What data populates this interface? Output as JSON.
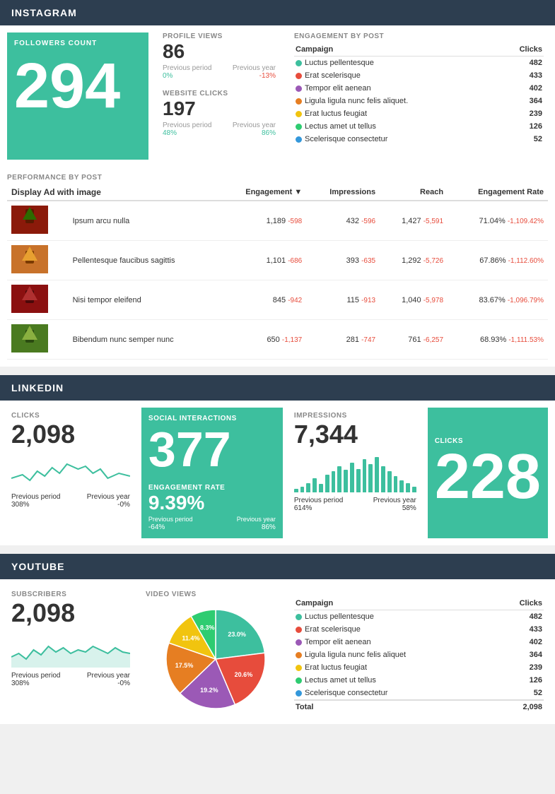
{
  "instagram": {
    "header": "INSTAGRAM",
    "followers": {
      "label": "FOLLOWERS COUNT",
      "value": "294"
    },
    "profile_views": {
      "label": "PROFILE VIEWS",
      "value": "86",
      "prev_period_label": "Previous period",
      "prev_period_value": "0%",
      "prev_year_label": "Previous year",
      "prev_year_value": "-13%"
    },
    "website_clicks": {
      "label": "WEBSITE CLICKS",
      "value": "197",
      "prev_period_label": "Previous period",
      "prev_period_value": "48%",
      "prev_year_label": "Previous year",
      "prev_year_value": "86%"
    },
    "engagement": {
      "label": "ENGAGEMENT BY POST",
      "col1": "Campaign",
      "col2": "Clicks",
      "rows": [
        {
          "color": "#3dbf9e",
          "name": "Luctus pellentesque",
          "clicks": "482"
        },
        {
          "color": "#e74c3c",
          "name": "Erat scelerisque",
          "clicks": "433"
        },
        {
          "color": "#9b59b6",
          "name": "Tempor elit aenean",
          "clicks": "402"
        },
        {
          "color": "#e67e22",
          "name": "Ligula ligula nunc felis aliquet.",
          "clicks": "364"
        },
        {
          "color": "#f1c40f",
          "name": "Erat luctus feugiat",
          "clicks": "239"
        },
        {
          "color": "#2ecc71",
          "name": "Lectus amet ut tellus",
          "clicks": "126"
        },
        {
          "color": "#3498db",
          "name": "Scelerisque consectetur",
          "clicks": "52"
        }
      ]
    },
    "performance": {
      "label": "PERFORMANCE BY POST",
      "subtitle": "Display Ad with image",
      "columns": [
        "",
        "Engagement",
        "Impressions",
        "Reach",
        "Engagement Rate"
      ],
      "rows": [
        {
          "img_color": "#8B1A0A",
          "name": "Ipsum arcu nulla",
          "engagement": "1,189",
          "engagement_delta": "-598",
          "impressions": "432",
          "impressions_delta": "-596",
          "reach": "1,427",
          "reach_delta": "-5,591",
          "rate": "71.04%",
          "rate_delta": "-1,109.42%"
        },
        {
          "img_color": "#D4640A",
          "name": "Pellentesque faucibus sagittis",
          "engagement": "1,101",
          "engagement_delta": "-686",
          "impressions": "393",
          "impressions_delta": "-635",
          "reach": "1,292",
          "reach_delta": "-5,726",
          "rate": "67.86%",
          "rate_delta": "-1,112.60%"
        },
        {
          "img_color": "#7B1010",
          "name": "Nisi tempor eleifend",
          "engagement": "845",
          "engagement_delta": "-942",
          "impressions": "115",
          "impressions_delta": "-913",
          "reach": "1,040",
          "reach_delta": "-5,978",
          "rate": "83.67%",
          "rate_delta": "-1,096.79%"
        },
        {
          "img_color": "#3A6B20",
          "name": "Bibendum nunc semper nunc",
          "engagement": "650",
          "engagement_delta": "-1,137",
          "impressions": "281",
          "impressions_delta": "-747",
          "reach": "761",
          "reach_delta": "-6,257",
          "rate": "68.93%",
          "rate_delta": "-1,111.53%"
        }
      ]
    }
  },
  "linkedin": {
    "header": "LINKEDIN",
    "clicks": {
      "label": "CLICKS",
      "value": "2,098",
      "prev_period_label": "Previous period",
      "prev_period_value": "308%",
      "prev_year_label": "Previous year",
      "prev_year_value": "-0%"
    },
    "social_interactions": {
      "label": "SOCIAL INTERACTIONS",
      "value": "377",
      "eng_label": "ENGAGEMENT RATE",
      "eng_value": "9.39%",
      "eng_prev_period": "-64%",
      "eng_prev_year": "86%"
    },
    "impressions": {
      "label": "IMPRESSIONS",
      "value": "7,344",
      "prev_period_label": "Previous period",
      "prev_period_value": "614%",
      "prev_year_label": "Previous year",
      "prev_year_value": "58%",
      "bars": [
        3,
        5,
        8,
        12,
        7,
        15,
        18,
        22,
        19,
        25,
        20,
        28,
        24,
        30,
        22,
        18,
        14,
        10,
        8,
        5
      ]
    },
    "li_clicks": {
      "label": "CLICKS",
      "value": "228"
    }
  },
  "youtube": {
    "header": "YOUTUBE",
    "subscribers": {
      "label": "SUBSCRIBERS",
      "value": "2,098",
      "prev_period_label": "Previous period",
      "prev_period_value": "308%",
      "prev_year_label": "Previous year",
      "prev_year_value": "-0%"
    },
    "video_views": {
      "label": "VIDEO VIEWS",
      "pie": [
        {
          "label": "Luctus pellentesque",
          "color": "#3dbf9e",
          "pct": 23.0,
          "start": 0
        },
        {
          "label": "Erat scelerisque",
          "color": "#e74c3c",
          "pct": 20.6,
          "start": 23.0
        },
        {
          "label": "Tempor elit aenean",
          "color": "#9b59b6",
          "pct": 19.2,
          "start": 43.6
        },
        {
          "label": "Ligula ligula nunc felis aliquet",
          "color": "#e67e22",
          "pct": 17.5,
          "start": 62.8
        },
        {
          "label": "Erat luctus feugiat",
          "color": "#f1c40f",
          "pct": 11.4,
          "start": 80.3
        },
        {
          "label": "Lectus amet ut tellus",
          "color": "#2ecc71",
          "pct": 8.3,
          "start": 91.7
        }
      ],
      "labels": [
        "23.0%",
        "20.6%",
        "19.2%",
        "17.5%",
        "11.4%"
      ]
    },
    "engagement": {
      "col1": "Campaign",
      "col2": "Clicks",
      "rows": [
        {
          "color": "#3dbf9e",
          "name": "Luctus pellentesque",
          "clicks": "482"
        },
        {
          "color": "#e74c3c",
          "name": "Erat scelerisque",
          "clicks": "433"
        },
        {
          "color": "#9b59b6",
          "name": "Tempor elit aenean",
          "clicks": "402"
        },
        {
          "color": "#e67e22",
          "name": "Ligula ligula nunc felis aliquet",
          "clicks": "364"
        },
        {
          "color": "#f1c40f",
          "name": "Erat luctus feugiat",
          "clicks": "239"
        },
        {
          "color": "#2ecc71",
          "name": "Lectus amet ut tellus",
          "clicks": "126"
        },
        {
          "color": "#3498db",
          "name": "Scelerisque consectetur",
          "clicks": "52"
        }
      ],
      "total_label": "Total",
      "total_value": "2,098"
    }
  }
}
